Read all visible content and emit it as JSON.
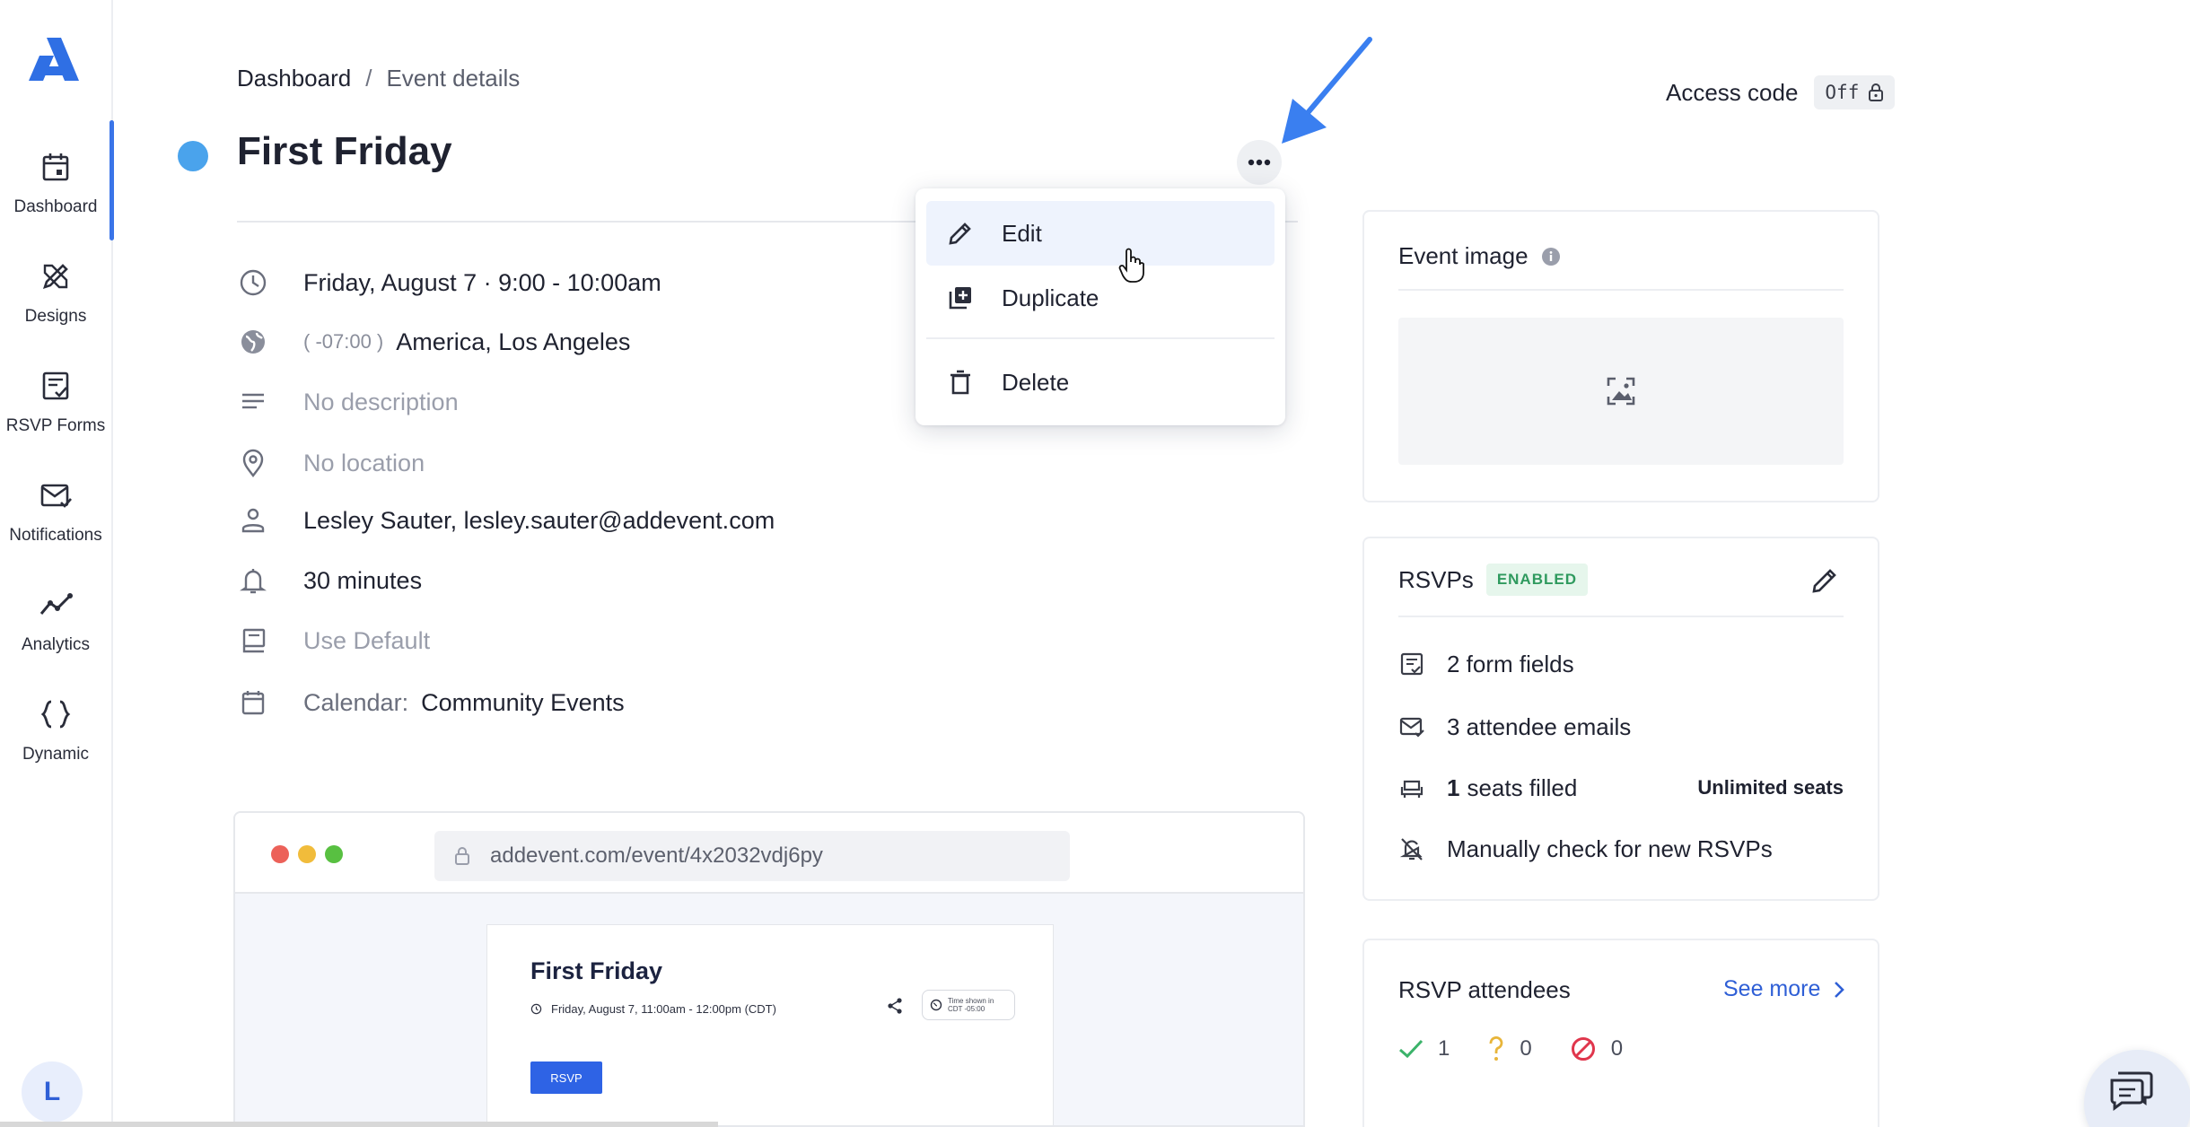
{
  "sidebar": {
    "items": [
      {
        "label": "Dashboard",
        "icon": "calendar-icon"
      },
      {
        "label": "Designs",
        "icon": "designs-icon"
      },
      {
        "label": "RSVP Forms",
        "icon": "rsvp-forms-icon"
      },
      {
        "label": "Notifications",
        "icon": "notifications-icon"
      },
      {
        "label": "Analytics",
        "icon": "analytics-icon"
      },
      {
        "label": "Dynamic",
        "icon": "braces-icon"
      }
    ],
    "avatar_initial": "L"
  },
  "header": {
    "breadcrumb_root": "Dashboard",
    "breadcrumb_separator": "/",
    "breadcrumb_current": "Event details",
    "access_code_label": "Access code",
    "access_code_value": "Off"
  },
  "event": {
    "title": "First Friday",
    "dot_color": "#4aa3ec",
    "date_time": "Friday, August 7 · 9:00 - 10:00am",
    "tz_offset": "( -07:00 )",
    "timezone": "America, Los Angeles",
    "description": "No description",
    "location": "No location",
    "organizer": "Lesley Sauter, lesley.sauter@addevent.com",
    "reminder": "30 minutes",
    "template": "Use Default",
    "calendar_label": "Calendar:",
    "calendar_value": "Community Events"
  },
  "menu": {
    "edit": "Edit",
    "duplicate": "Duplicate",
    "delete": "Delete"
  },
  "preview": {
    "url": "addevent.com/event/4x2032vdj6py",
    "title": "First Friday",
    "date": "Friday, August 7, 11:00am - 12:00pm (CDT)",
    "tz_line1": "Time shown in",
    "tz_line2": "CDT -05:00",
    "rsvp_button": "RSVP"
  },
  "event_image": {
    "title": "Event image"
  },
  "rsvps": {
    "title": "RSVPs",
    "status": "ENABLED",
    "form_fields": "2 form fields",
    "attendee_emails": "3 attendee emails",
    "seats_count": "1",
    "seats_label": "seats filled",
    "seats_limit": "Unlimited seats",
    "check_label": "Manually check for new RSVPs"
  },
  "attendees": {
    "title": "RSVP attendees",
    "see_more": "See more",
    "yes_count": "1",
    "maybe_count": "0",
    "no_count": "0"
  },
  "colors": {
    "accent": "#2f5fd6",
    "arrow": "#3a7ff0",
    "enabled_green": "#2f9a5e",
    "yes_green": "#3bb36a",
    "maybe_yellow": "#e8b53a",
    "no_red": "#e0364c"
  }
}
